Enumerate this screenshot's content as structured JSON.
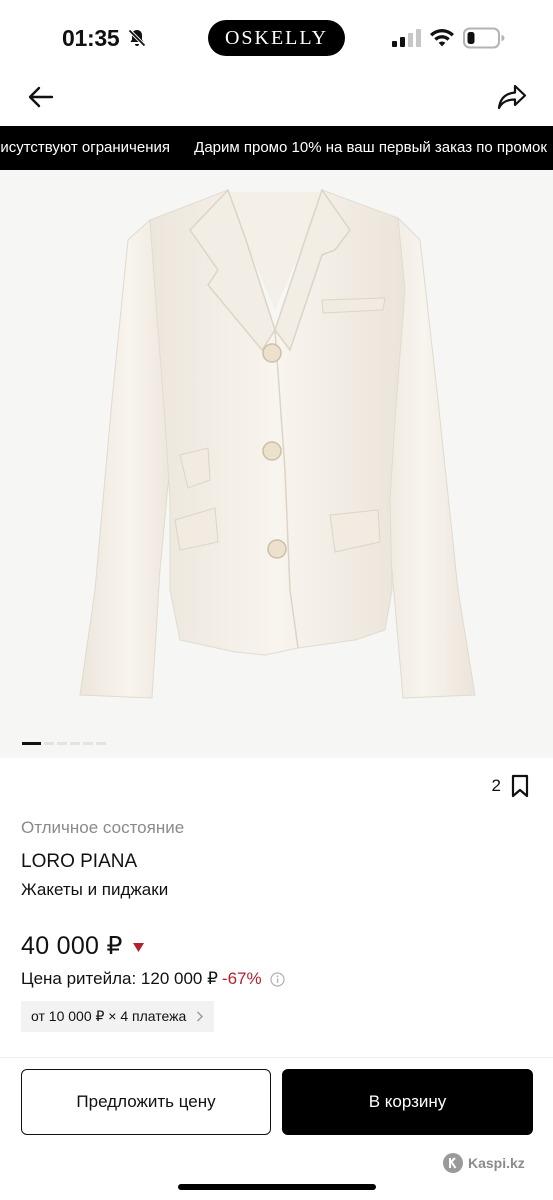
{
  "status_bar": {
    "time": "01:35",
    "app_logo": "OSKELLY",
    "icons": [
      "bell-muted-icon",
      "signal-icon",
      "wifi-icon",
      "battery-icon"
    ]
  },
  "nav": {
    "back_icon": "arrow-left-icon",
    "share_icon": "share-icon"
  },
  "ticker": {
    "items": [
      "рисутствуют ограничения",
      "Дарим промо 10% на ваш первый заказ по промок"
    ]
  },
  "gallery": {
    "image_description_icon": "product-photo",
    "slide_count": 6,
    "active_slide": 1
  },
  "product": {
    "favorites_count": "2",
    "condition": "Отличное состояние",
    "brand": "LORO PIANA",
    "category": "Жакеты и пиджаки",
    "price": "40 000 ₽",
    "retail_label": "Цена ритейла: 120 000 ₽",
    "discount": "-67%",
    "installments": "от 10 000 ₽ × 4 платежа"
  },
  "actions": {
    "offer_label": "Предложить цену",
    "cart_label": "В корзину"
  },
  "watermark": {
    "text": "Kaspi.kz"
  },
  "colors": {
    "accent": "#000000",
    "discount": "#b51f2e",
    "muted_text": "#8a8a8a"
  }
}
